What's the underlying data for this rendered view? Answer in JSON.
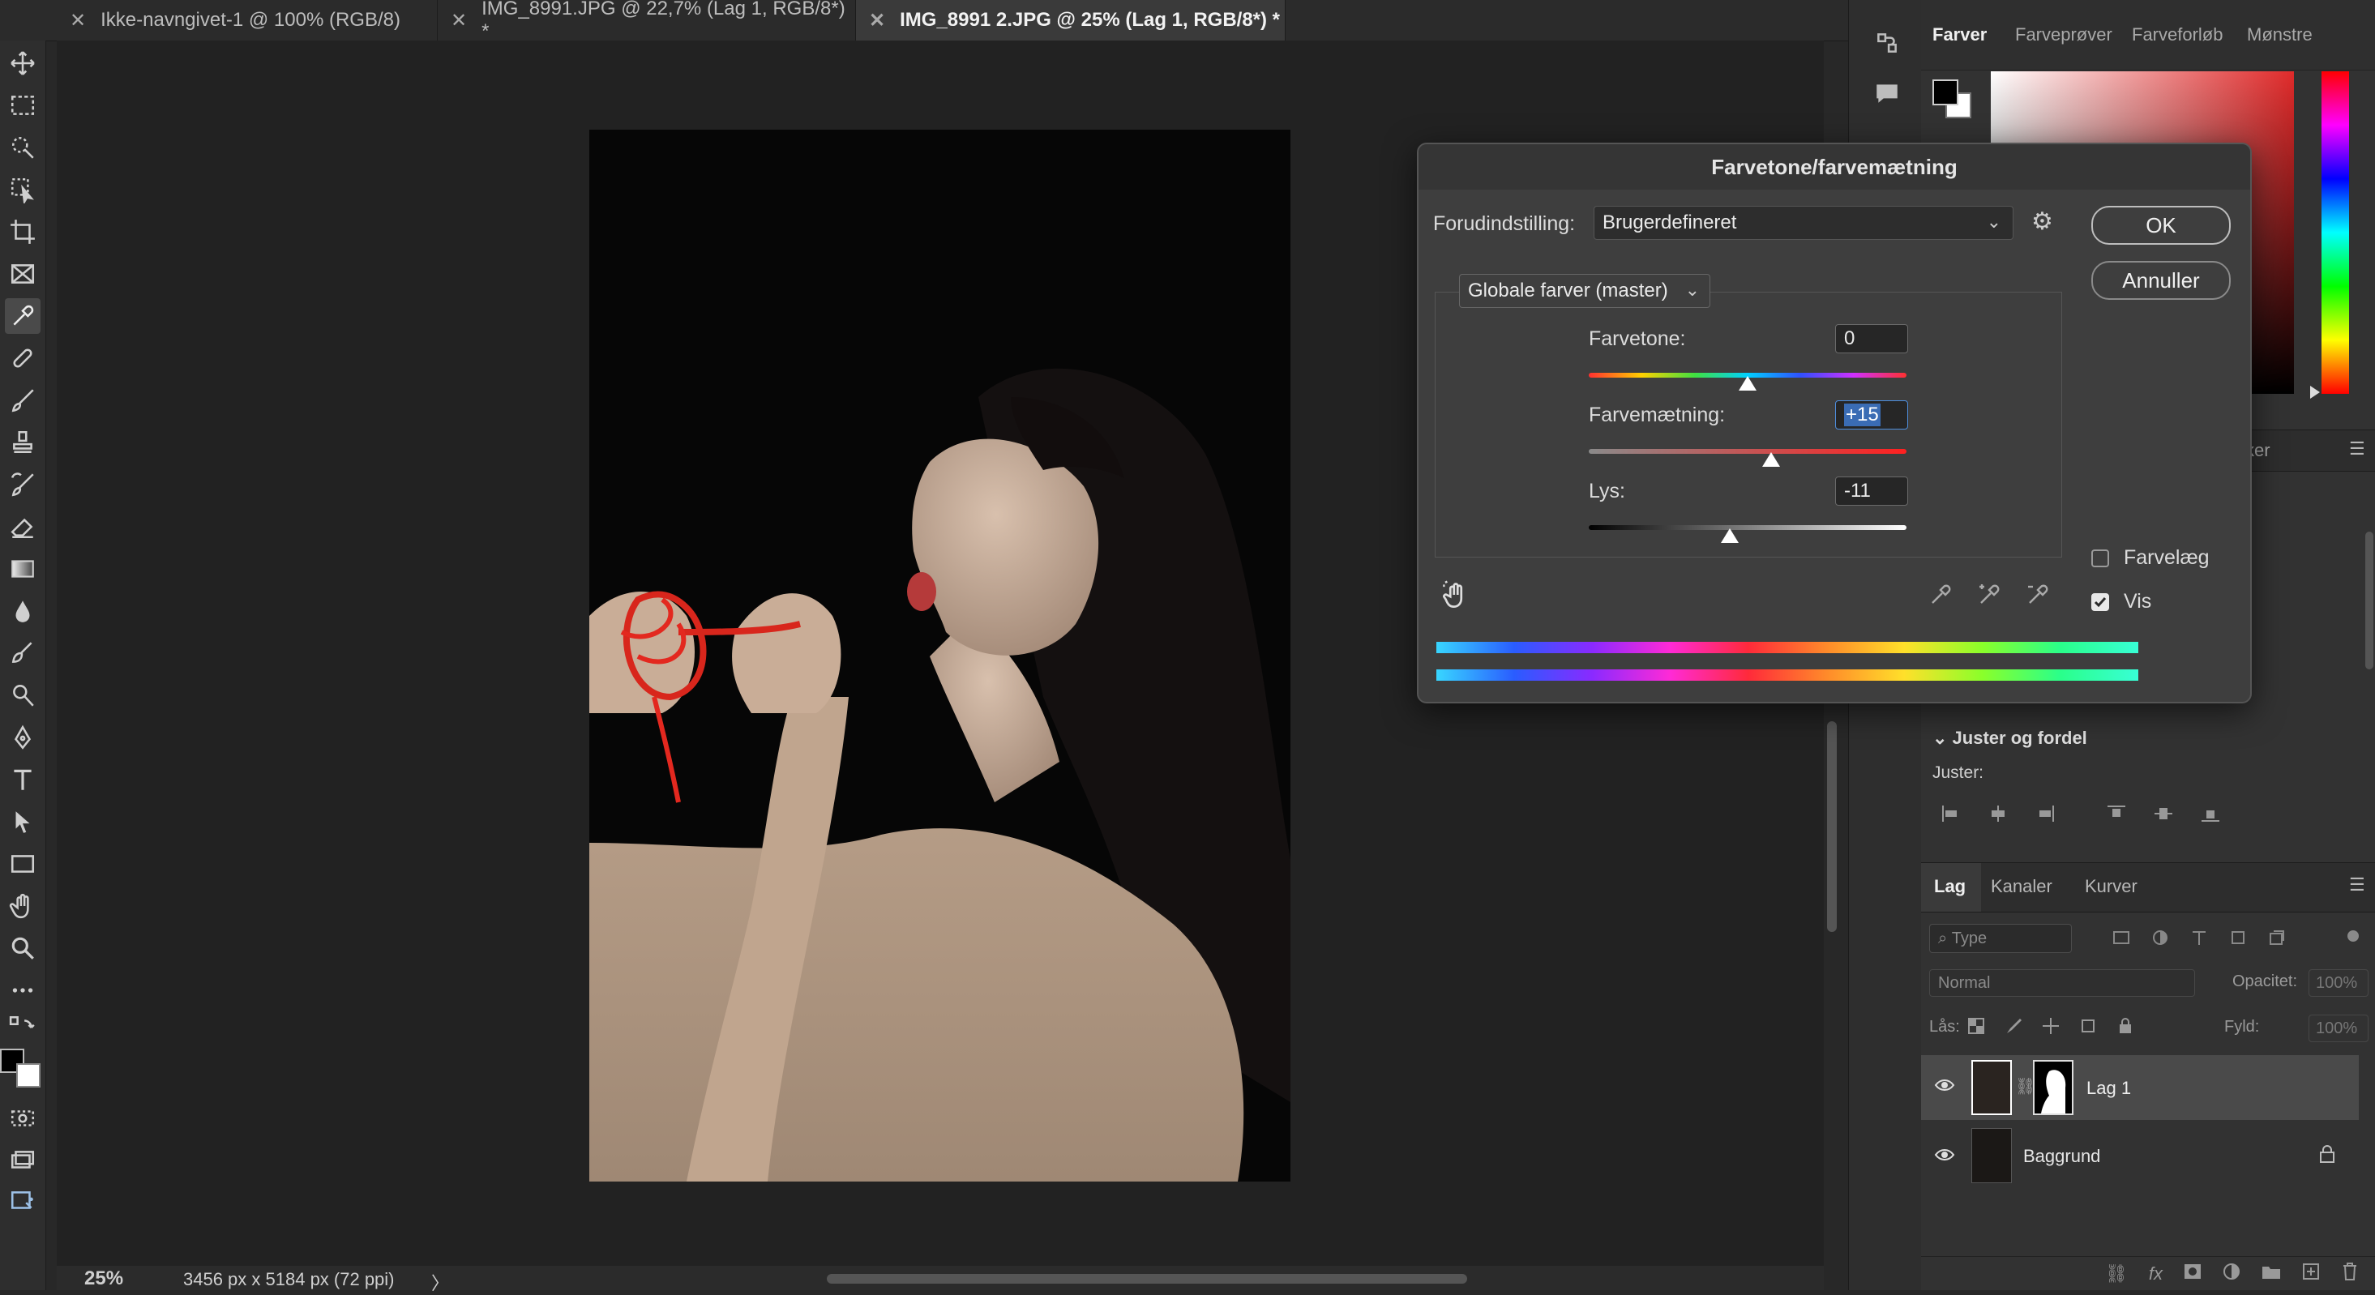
{
  "tabs": [
    {
      "label": "Ikke-navngivet-1 @ 100% (RGB/8)",
      "active": false
    },
    {
      "label": "IMG_8991.JPG @ 22,7% (Lag 1, RGB/8*) *",
      "active": false
    },
    {
      "label": "IMG_8991 2.JPG @ 25% (Lag 1, RGB/8*) *",
      "active": true
    }
  ],
  "status": {
    "zoom": "25%",
    "dimensions": "3456 px x 5184 px (72 ppi)",
    "arrow": "〉"
  },
  "color_panel": {
    "tabs": [
      "Farver",
      "Farveprøver",
      "Farveforløb",
      "Mønstre"
    ],
    "active_tab": "Farver",
    "foreground": "#000000",
    "background": "#ffffff"
  },
  "hidden_tab_fragment": "ker",
  "align_panel": {
    "title": "Juster og fordel",
    "label": "Juster:"
  },
  "layers_panel": {
    "tabs": [
      "Lag",
      "Kanaler",
      "Kurver"
    ],
    "active_tab": "Lag",
    "filter_placeholder": "Type",
    "blend_mode": "Normal",
    "opacity_label": "Opacitet:",
    "opacity_value": "100%",
    "lock_label": "Lås:",
    "fill_label": "Fyld:",
    "fill_value": "100%",
    "layers": [
      {
        "name": "Lag 1",
        "selected": true,
        "has_mask": true,
        "locked": false
      },
      {
        "name": "Baggrund",
        "selected": false,
        "has_mask": false,
        "locked": true
      }
    ]
  },
  "dialog": {
    "title": "Farvetone/farvemætning",
    "preset_label": "Forudindstilling:",
    "preset_value": "Brugerdefineret",
    "ok": "OK",
    "cancel": "Annuller",
    "channel": "Globale farver (master)",
    "hue_label": "Farvetone:",
    "hue_value": "0",
    "saturation_label": "Farvemætning:",
    "saturation_value": "+15",
    "lightness_label": "Lys:",
    "lightness_value": "-11",
    "colorize_label": "Farvelæg",
    "colorize_checked": false,
    "preview_label": "Vis",
    "preview_checked": true,
    "hue_slider_fraction": 0.5,
    "saturation_slider_fraction": 0.575,
    "lightness_slider_fraction": 0.445
  }
}
